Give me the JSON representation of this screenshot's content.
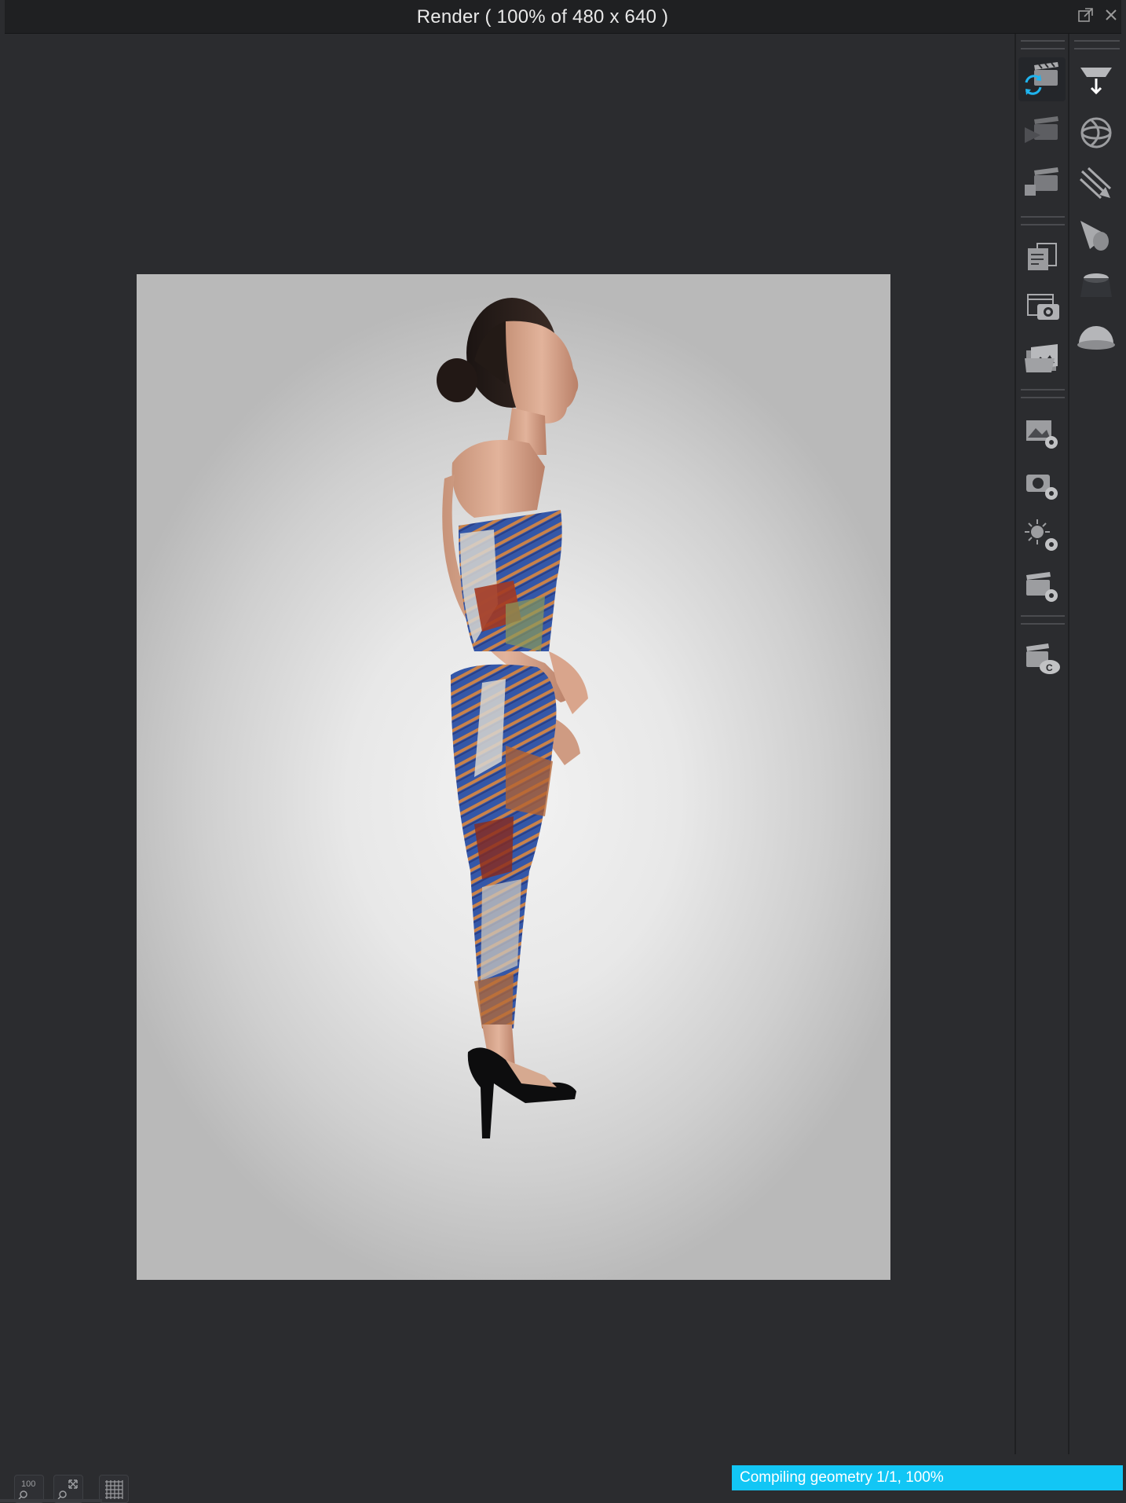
{
  "window": {
    "title": "Render ( 100% of 480 x 640 )",
    "popout_icon": "popout-icon",
    "close_icon": "close-icon"
  },
  "render": {
    "zoom_percent": 100,
    "image_width": 480,
    "image_height": 640
  },
  "toolbar_left": {
    "groups": [
      [
        "render-refresh-icon",
        "render-play-icon",
        "render-region-icon"
      ],
      [
        "copy-render-icon",
        "save-render-icon",
        "open-render-icon"
      ],
      [
        "image-settings-icon",
        "camera-settings-icon",
        "light-settings-icon",
        "render-settings-icon"
      ],
      [
        "cloud-render-icon"
      ]
    ],
    "active_tool": "render-refresh-icon"
  },
  "toolbar_right": {
    "tools": [
      "drop-light-icon",
      "environment-icon",
      "directional-light-icon",
      "spot-light-icon",
      "area-light-icon",
      "dome-light-icon"
    ]
  },
  "bottom": {
    "zoom_100_label": "100",
    "fit_icon": "zoom-fit-icon",
    "grid_icon": "grid-icon",
    "status_text": "Compiling geometry 1/1, 100%",
    "status_progress": 1.0,
    "colors": {
      "progress": "#12c6f5",
      "accent": "#1fb4ef"
    }
  }
}
